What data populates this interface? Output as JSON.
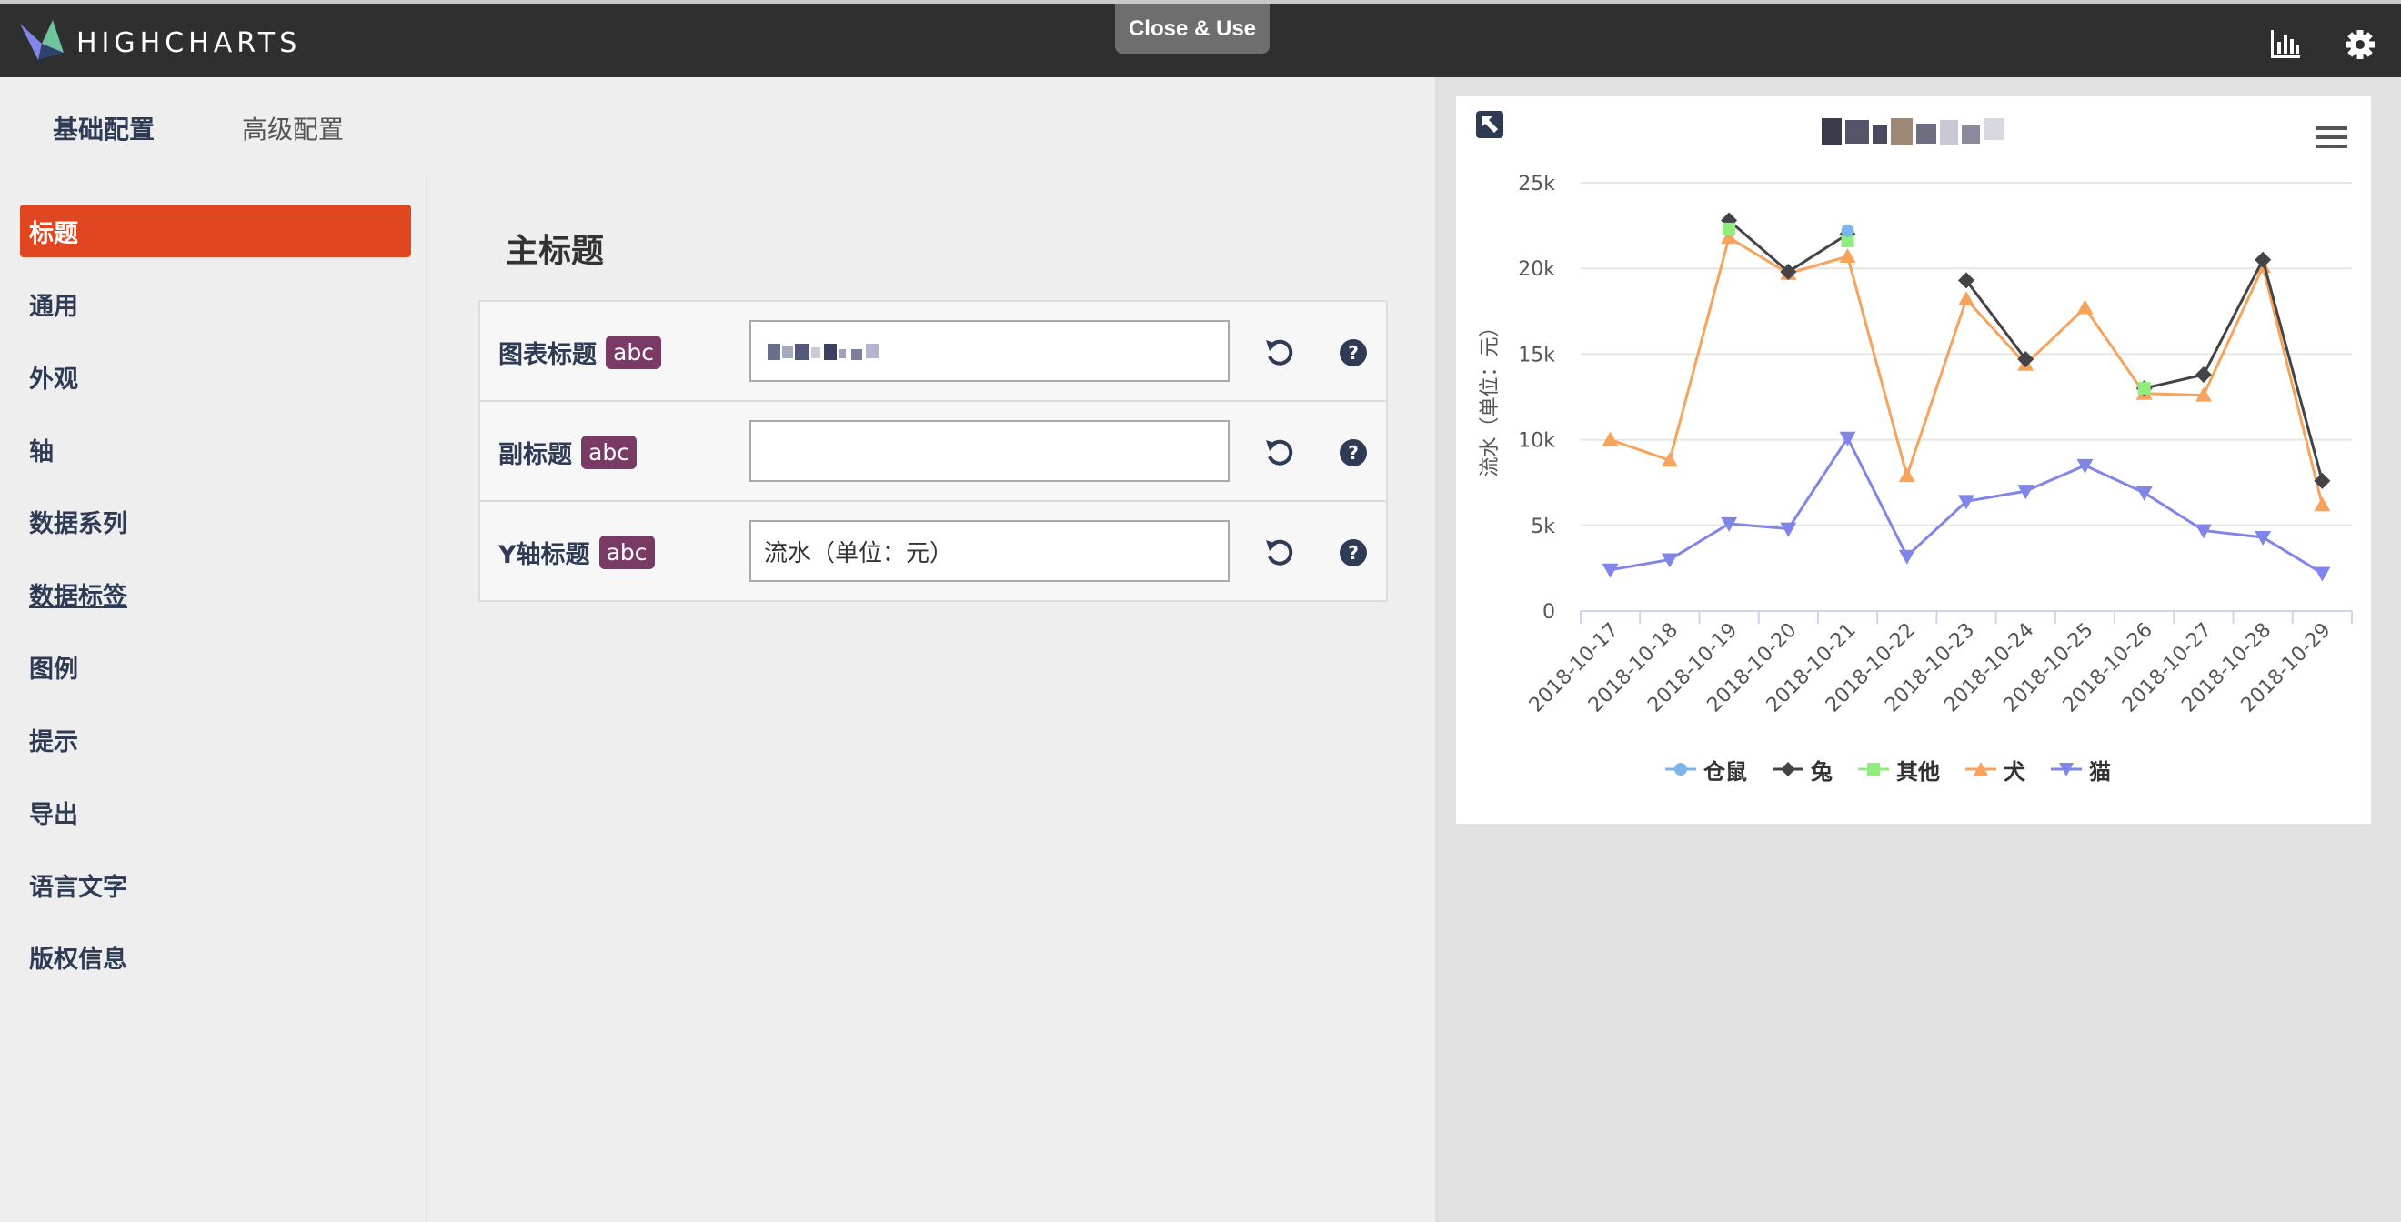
{
  "app": {
    "brand": "HIGHCHARTS",
    "close_use": "Close & Use"
  },
  "tabs": [
    {
      "label": "基础配置"
    },
    {
      "label": "高级配置"
    }
  ],
  "sidebar": {
    "items": [
      {
        "label": "标题"
      },
      {
        "label": "通用"
      },
      {
        "label": "外观"
      },
      {
        "label": "轴"
      },
      {
        "label": "数据系列"
      },
      {
        "label": "数据标签"
      },
      {
        "label": "图例"
      },
      {
        "label": "提示"
      },
      {
        "label": "导出"
      },
      {
        "label": "语言文字"
      },
      {
        "label": "版权信息"
      }
    ]
  },
  "section": {
    "title": "主标题"
  },
  "form": {
    "rows": [
      {
        "label": "图表标题",
        "badge": "abc",
        "value": ""
      },
      {
        "label": "副标题",
        "badge": "abc",
        "value": ""
      },
      {
        "label": "Y轴标题",
        "badge": "abc",
        "value": "流水（单位：元）"
      }
    ]
  },
  "icons": {
    "logo": "highcharts-logo-icon",
    "chart": "bar-chart-icon",
    "settings": "gear-icon",
    "reset": "undo-icon",
    "help": "help-icon",
    "expand": "expand-arrow-icon",
    "menu": "hamburger-menu-icon"
  },
  "colors": {
    "accent": "#e0461f",
    "badge": "#7a3a66",
    "topbar": "#2f2f2f"
  },
  "chart_data": {
    "type": "line",
    "ylabel": "流水（单位：元）",
    "ylim": [
      0,
      25000
    ],
    "yticks": [
      "0",
      "5k",
      "10k",
      "15k",
      "20k",
      "25k"
    ],
    "yticks_values": [
      0,
      5000,
      10000,
      15000,
      20000,
      25000
    ],
    "categories": [
      "2018-10-17",
      "2018-10-18",
      "2018-10-19",
      "2018-10-20",
      "2018-10-21",
      "2018-10-22",
      "2018-10-23",
      "2018-10-24",
      "2018-10-25",
      "2018-10-26",
      "2018-10-27",
      "2018-10-28",
      "2018-10-29"
    ],
    "legend_position": "bottom",
    "grid": true,
    "series": [
      {
        "name": "仓鼠",
        "color": "#7cb5ec",
        "marker": "circle",
        "values": [
          null,
          null,
          null,
          null,
          22200,
          null,
          null,
          null,
          null,
          null,
          null,
          null,
          null
        ]
      },
      {
        "name": "兔",
        "color": "#434348",
        "marker": "diamond",
        "values": [
          null,
          null,
          22800,
          19800,
          22000,
          null,
          19300,
          14700,
          null,
          13000,
          13800,
          20500,
          7600
        ]
      },
      {
        "name": "其他",
        "color": "#90ed7d",
        "marker": "square",
        "values": [
          null,
          null,
          22300,
          null,
          21600,
          null,
          null,
          null,
          null,
          13000,
          null,
          null,
          null
        ]
      },
      {
        "name": "犬",
        "color": "#f7a35c",
        "marker": "triangle",
        "values": [
          10000,
          8800,
          21800,
          19700,
          20700,
          7900,
          18200,
          14400,
          17700,
          12700,
          12600,
          20100,
          6200
        ]
      },
      {
        "name": "猫",
        "color": "#8085e9",
        "marker": "triangle-down",
        "values": [
          2400,
          3000,
          5100,
          4800,
          10100,
          3200,
          6400,
          7000,
          8500,
          6900,
          4700,
          4300,
          2200
        ]
      }
    ]
  }
}
